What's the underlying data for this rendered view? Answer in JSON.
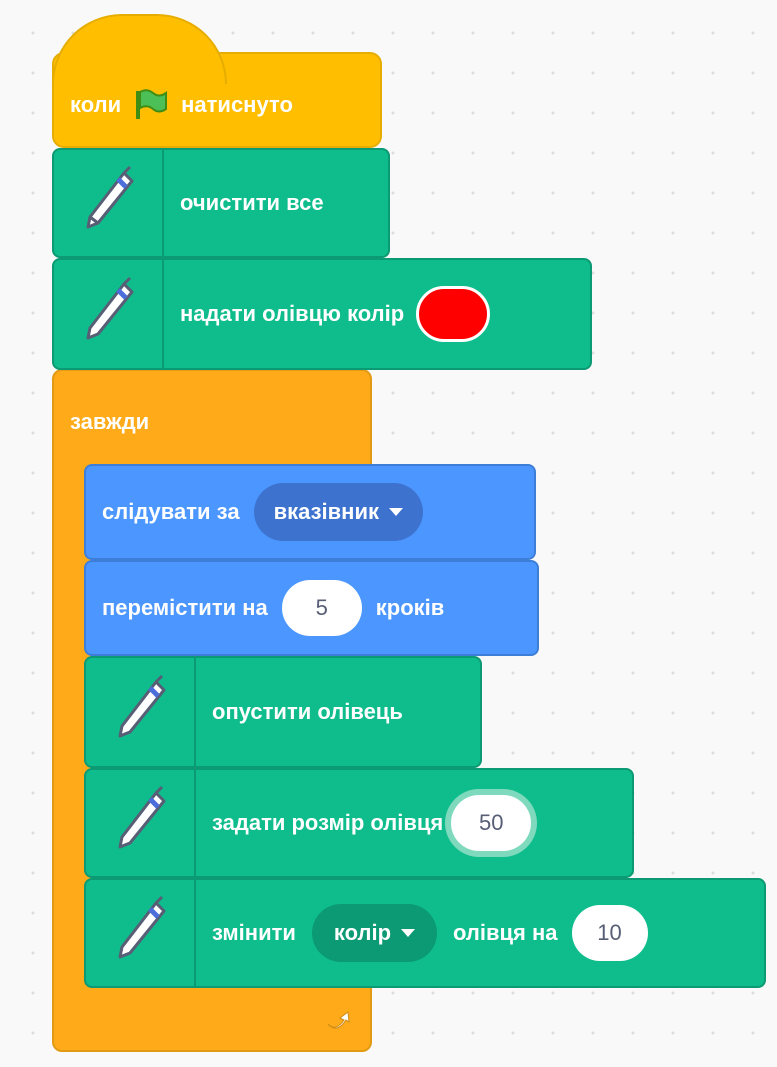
{
  "hat": {
    "before": "коли",
    "after": "натиснуто",
    "flag_icon": "green-flag"
  },
  "clear_block": {
    "label": "очистити все"
  },
  "set_color_block": {
    "label": "надати олівцю колір",
    "color": "#ff0000"
  },
  "forever_block": {
    "label": "завжди",
    "loop_icon": "loop-arrow"
  },
  "point_towards_block": {
    "label": "слідувати за",
    "target": "вказівник"
  },
  "move_block": {
    "label_before": "перемістити на",
    "steps": "5",
    "label_after": "кроків"
  },
  "pen_down_block": {
    "label": "опустити олівець"
  },
  "set_size_block": {
    "label": "задати розмір олівця",
    "size": "50"
  },
  "change_color_block": {
    "label_before": "змінити",
    "param": "колір",
    "label_after": "олівця на",
    "amount": "10"
  },
  "colors": {
    "events": "#ffbf00",
    "control": "#ffab19",
    "motion": "#4c97ff",
    "pen": "#0fbd8c"
  }
}
